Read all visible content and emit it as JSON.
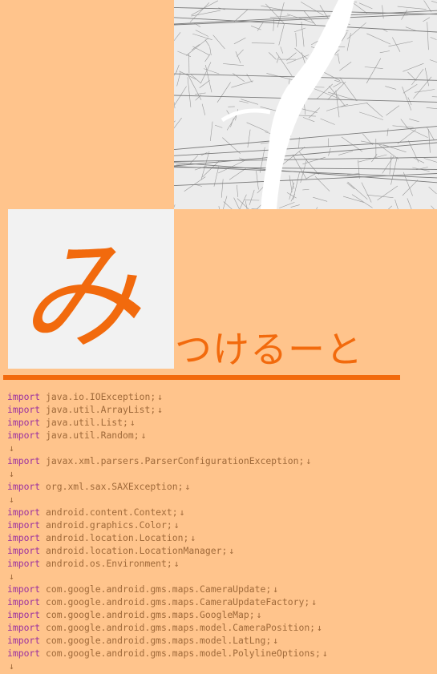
{
  "title": {
    "logo_char": "み",
    "rest": "つけるーと"
  },
  "code": {
    "keyword": "import",
    "newline_mark": "↓",
    "lines": [
      {
        "keyword": "import",
        "text": "java.io.IOException;"
      },
      {
        "keyword": "import",
        "text": "java.util.ArrayList;"
      },
      {
        "keyword": "import",
        "text": "java.util.List;"
      },
      {
        "keyword": "import",
        "text": "java.util.Random;"
      },
      {
        "keyword": "",
        "text": ""
      },
      {
        "keyword": "import",
        "text": "javax.xml.parsers.ParserConfigurationException;"
      },
      {
        "keyword": "",
        "text": ""
      },
      {
        "keyword": "import",
        "text": "org.xml.sax.SAXException;"
      },
      {
        "keyword": "",
        "text": ""
      },
      {
        "keyword": "import",
        "text": "android.content.Context;"
      },
      {
        "keyword": "import",
        "text": "android.graphics.Color;"
      },
      {
        "keyword": "import",
        "text": "android.location.Location;"
      },
      {
        "keyword": "import",
        "text": "android.location.LocationManager;"
      },
      {
        "keyword": "import",
        "text": "android.os.Environment;"
      },
      {
        "keyword": "",
        "text": ""
      },
      {
        "keyword": "import",
        "text": "com.google.android.gms.maps.CameraUpdate;"
      },
      {
        "keyword": "import",
        "text": "com.google.android.gms.maps.CameraUpdateFactory;"
      },
      {
        "keyword": "import",
        "text": "com.google.android.gms.maps.GoogleMap;"
      },
      {
        "keyword": "import",
        "text": "com.google.android.gms.maps.model.CameraPosition;"
      },
      {
        "keyword": "import",
        "text": "com.google.android.gms.maps.model.LatLng;"
      },
      {
        "keyword": "import",
        "text": "com.google.android.gms.maps.model.PolylineOptions;"
      },
      {
        "keyword": "",
        "text": ""
      }
    ]
  },
  "colors": {
    "background": "#ffc48c",
    "accent": "#f26a0d",
    "keyword": "#9b2fa0",
    "map_bg": "#ececec",
    "river": "#ffffff"
  }
}
